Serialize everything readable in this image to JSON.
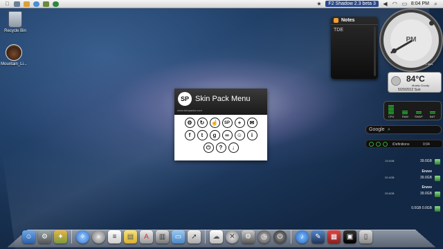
{
  "menubar": {
    "apple_icon": "apple-icon",
    "active_app": "F2 Shadow 2.3 beta 3",
    "time": "8:04 PM",
    "status_icons": [
      "volume-icon",
      "wifi-icon",
      "battery-icon",
      "search-icon"
    ]
  },
  "desktop": {
    "icons": [
      {
        "label": "Recycle Bin"
      },
      {
        "label": "Mountain_Li..."
      }
    ]
  },
  "skinpack": {
    "logo": "SP",
    "title": "Skin Pack Menu",
    "url": "www.skinpacks.com",
    "row1": [
      "⚙",
      "↻",
      "☝",
      "SP",
      "+",
      "✉"
    ],
    "row2": [
      "f",
      "t",
      "g",
      "∞",
      "☺",
      "i"
    ],
    "row3": [
      "⏻",
      "?",
      "↓"
    ]
  },
  "notes": {
    "title": "Notes",
    "content": "TDE"
  },
  "clock": {
    "ampm": "PM",
    "label": "Fe Mes"
  },
  "weather": {
    "temp": "84°C",
    "condition": "Mostly Cloudy",
    "date": "5/20/2012 Sun"
  },
  "meters": {
    "labels": [
      "CPU",
      "RAM",
      "SWAP",
      "BAT"
    ],
    "levels": [
      0.9,
      0.35,
      0.25,
      0.3
    ]
  },
  "google": {
    "label": "Google"
  },
  "player": {
    "title": "iDefinitions",
    "time": "0:04"
  },
  "drives": [
    {
      "name": "",
      "left": "13.5GB",
      "right": "39.0GB"
    },
    {
      "name": "Enzee",
      "left": "20.4GB",
      "right": "39.0GB"
    },
    {
      "name": "Enzee",
      "left": "29.8GB",
      "right": "39.0GB"
    },
    {
      "name": "",
      "left": "",
      "right": "0.0GB  0.0GB"
    }
  ],
  "dock": {
    "icons": [
      "finder-icon",
      "system-prefs-icon",
      "tools-icon",
      "safari-icon",
      "spotlight-icon",
      "notepad-icon",
      "stickies-icon",
      "app-store-icon",
      "printer-icon",
      "folder-icon",
      "share-icon",
      "cloud-icon",
      "wrench-icon",
      "settings-icon",
      "time-machine-icon",
      "power-icon",
      "itunes-icon",
      "appstore2-icon",
      "calendar-icon",
      "photo-booth-icon",
      "trash-icon"
    ]
  }
}
